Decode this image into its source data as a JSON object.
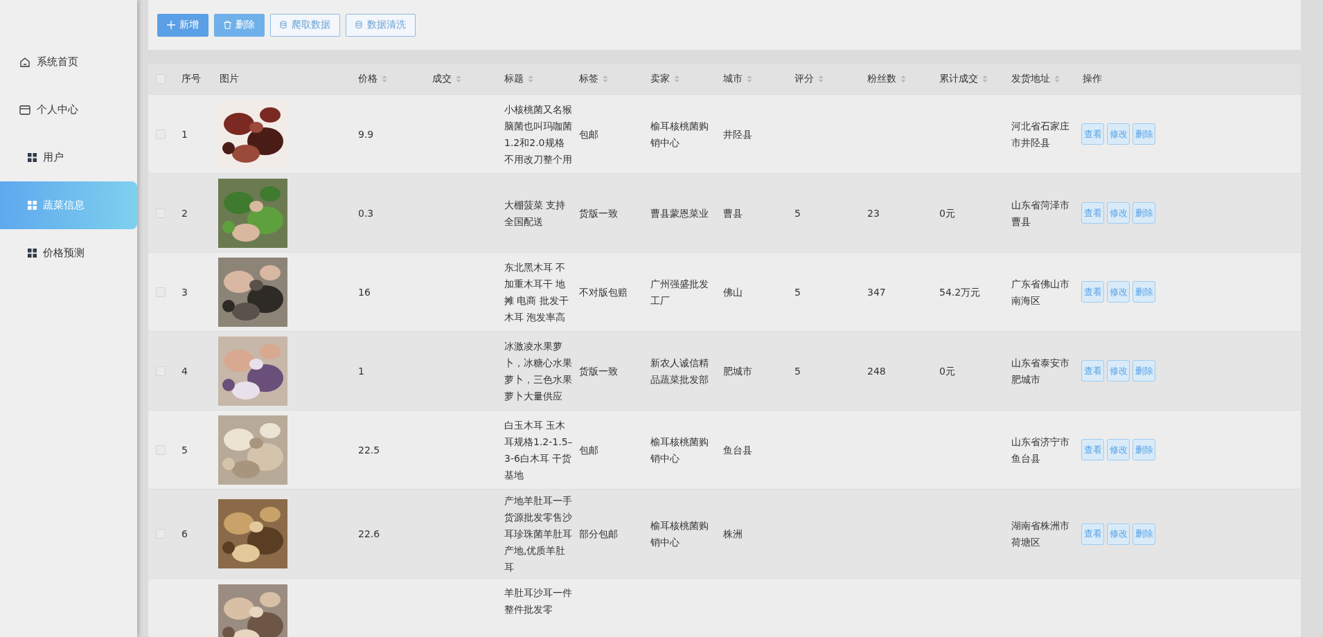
{
  "sidebar": {
    "items": [
      {
        "label": "系统首页",
        "kind": "home",
        "selected": false
      },
      {
        "label": "个人中心",
        "kind": "card",
        "selected": false
      },
      {
        "label": "用户",
        "kind": "grid",
        "selected": false
      },
      {
        "label": "蔬菜信息",
        "kind": "grid",
        "selected": true
      },
      {
        "label": "价格预测",
        "kind": "grid",
        "selected": false
      }
    ]
  },
  "toolbar": {
    "buttons": [
      {
        "label": "新增",
        "kind": "add"
      },
      {
        "label": "删除",
        "kind": "delete"
      },
      {
        "label": "爬取数据",
        "kind": "data"
      },
      {
        "label": "数据清洗",
        "kind": "data"
      }
    ]
  },
  "table": {
    "select_all": false,
    "columns": [
      {
        "label": "序号",
        "sortable": false
      },
      {
        "label": "图片",
        "sortable": false
      },
      {
        "label": "价格",
        "sortable": true
      },
      {
        "label": "成交",
        "sortable": true
      },
      {
        "label": "标题",
        "sortable": true
      },
      {
        "label": "标签",
        "sortable": true
      },
      {
        "label": "卖家",
        "sortable": true
      },
      {
        "label": "城市",
        "sortable": true
      },
      {
        "label": "评分",
        "sortable": true
      },
      {
        "label": "粉丝数",
        "sortable": true
      },
      {
        "label": "累计成交",
        "sortable": true
      },
      {
        "label": "发货地址",
        "sortable": true
      },
      {
        "label": "操作",
        "sortable": false
      }
    ],
    "rows": [
      {
        "checked": false,
        "index": "1",
        "price": "9.9",
        "title": "小核桃菌又名猴脑菌也叫玛咖菌1.2和2.0规格不用改刀整个用",
        "tag": "包邮",
        "seller": "榆耳核桃菌购销中心",
        "city": "井陉县",
        "address": "河北省石家庄市井陉县",
        "actions": [
          "查看",
          "修改",
          "删除"
        ]
      },
      {
        "checked": false,
        "index": "2",
        "price": "0.3",
        "title": "大棚菠菜 支持全国配送",
        "tag": "货版一致",
        "seller": "曹县蒙恩菜业",
        "city": "曹县",
        "rating": "5",
        "fans": "23",
        "total": "0元",
        "address": "山东省菏泽市曹县",
        "actions": [
          "查看",
          "修改",
          "删除"
        ]
      },
      {
        "checked": false,
        "index": "3",
        "price": "16",
        "title": "东北黑木耳 不加重木耳干 地摊 电商 批发干木耳 泡发率高",
        "tag": "不对版包赔",
        "seller": "广州强盛批发工厂",
        "city": "佛山",
        "rating": "5",
        "fans": "347",
        "total": "54.2万元",
        "address": "广东省佛山市南海区",
        "actions": [
          "查看",
          "修改",
          "删除"
        ]
      },
      {
        "checked": false,
        "index": "4",
        "price": "1",
        "title": "冰激凌水果萝卜，冰糖心水果萝卜，三色水果萝卜大量供应",
        "tag": "货版一致",
        "seller": "新农人诚信精品蔬菜批发部",
        "city": "肥城市",
        "rating": "5",
        "fans": "248",
        "total": "0元",
        "address": "山东省泰安市肥城市",
        "actions": [
          "查看",
          "修改",
          "删除"
        ]
      },
      {
        "checked": false,
        "index": "5",
        "price": "22.5",
        "title": "白玉木耳 玉木耳规格1.2-1.5–3-6白木耳 干货基地",
        "tag": "包邮",
        "seller": "榆耳核桃菌购销中心",
        "city": "鱼台县",
        "address": "山东省济宁市鱼台县",
        "actions": [
          "查看",
          "修改",
          "删除"
        ]
      },
      {
        "checked": false,
        "index": "6",
        "price": "22.6",
        "title": "产地羊肚耳一手货源批发零售沙耳珍珠菌羊肚耳产地,优质羊肚耳",
        "tag": "部分包邮",
        "seller": "榆耳核桃菌购销中心",
        "city": "株洲",
        "address": "湖南省株洲市荷塘区",
        "actions": [
          "查看",
          "修改",
          "删除"
        ]
      },
      {
        "title": "羊肚耳沙耳一件整件批发零"
      }
    ]
  }
}
